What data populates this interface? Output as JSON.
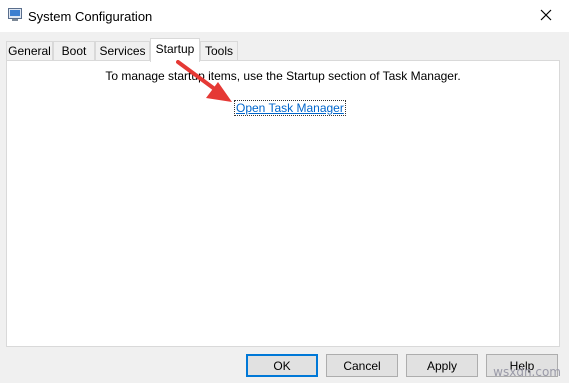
{
  "window": {
    "title": "System Configuration",
    "icon": "msconfig-icon"
  },
  "tabs": [
    {
      "label": "General"
    },
    {
      "label": "Boot"
    },
    {
      "label": "Services"
    },
    {
      "label": "Startup",
      "active": true
    },
    {
      "label": "Tools"
    }
  ],
  "startup": {
    "message": "To manage startup items, use the Startup section of Task Manager.",
    "link": "Open Task Manager"
  },
  "buttons": {
    "ok": "OK",
    "cancel": "Cancel",
    "apply": "Apply",
    "help": "Help"
  },
  "watermark": "wsxdn.com",
  "colors": {
    "link": "#0066cc",
    "arrow": "#e53935",
    "focus": "#0078d7"
  }
}
